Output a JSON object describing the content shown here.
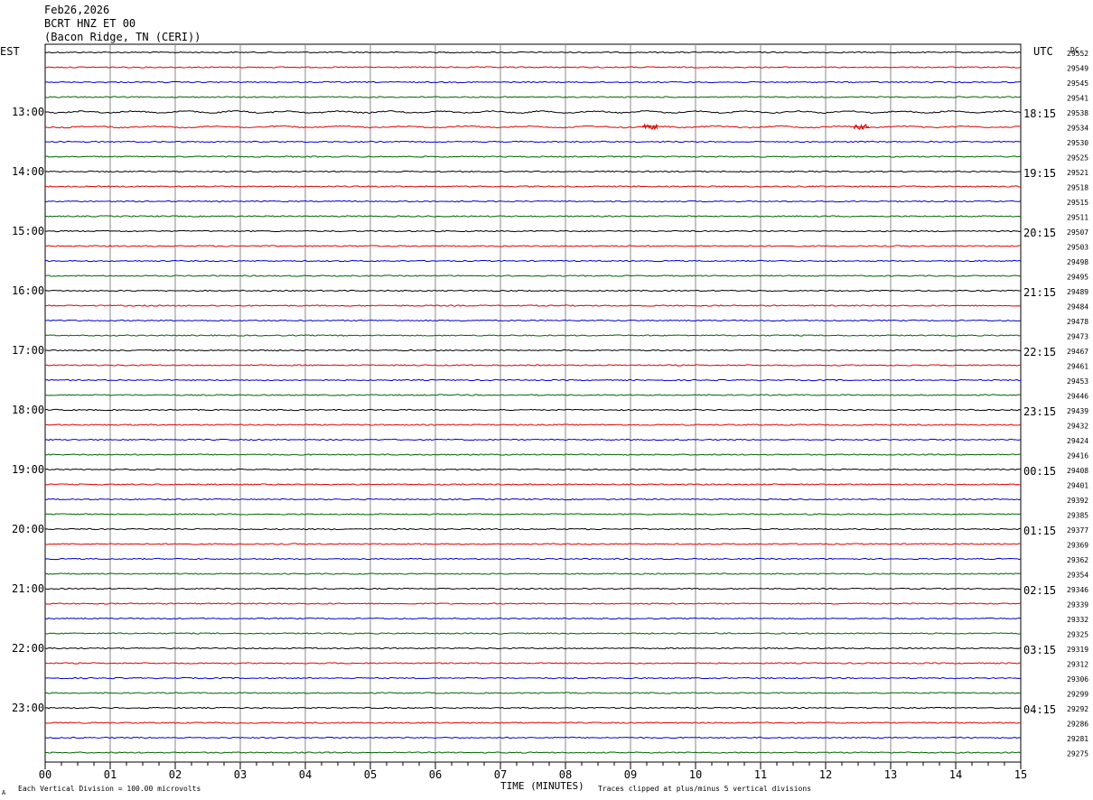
{
  "header": {
    "date": "Feb26,2026",
    "station": "BCRT HNZ ET 00",
    "location": "(Bacon Ridge, TN (CERI))"
  },
  "left_label": "EST",
  "right_label": "UTC",
  "dc_label": "DC",
  "footer": {
    "scale_note": "Each Vertical Division =  100.00 microvolts",
    "xlabel": "TIME (MINUTES)",
    "clip_note": "Traces clipped at plus/minus 5 vertical divisions",
    "corner_mark": "A"
  },
  "chart_data": {
    "type": "line",
    "title": "BCRT HNZ ET 00",
    "xlabel": "TIME (MINUTES)",
    "x_ticks": [
      "00",
      "01",
      "02",
      "03",
      "04",
      "05",
      "06",
      "07",
      "08",
      "09",
      "10",
      "11",
      "12",
      "13",
      "14",
      "15"
    ],
    "xlim": [
      0,
      15
    ],
    "grid": true,
    "trace_colors": [
      "#000000",
      "#e00000",
      "#0000d0",
      "#006400"
    ],
    "est_hour_labels": [
      {
        "row": 4,
        "label": "13:00"
      },
      {
        "row": 8,
        "label": "14:00"
      },
      {
        "row": 12,
        "label": "15:00"
      },
      {
        "row": 16,
        "label": "16:00"
      },
      {
        "row": 20,
        "label": "17:00"
      },
      {
        "row": 24,
        "label": "18:00"
      },
      {
        "row": 28,
        "label": "19:00"
      },
      {
        "row": 32,
        "label": "20:00"
      },
      {
        "row": 36,
        "label": "21:00"
      },
      {
        "row": 40,
        "label": "22:00"
      },
      {
        "row": 44,
        "label": "23:00"
      }
    ],
    "utc_hour_labels": [
      {
        "row": 4,
        "label": "18:15"
      },
      {
        "row": 8,
        "label": "19:15"
      },
      {
        "row": 12,
        "label": "20:15"
      },
      {
        "row": 16,
        "label": "21:15"
      },
      {
        "row": 20,
        "label": "22:15"
      },
      {
        "row": 24,
        "label": "23:15"
      },
      {
        "row": 28,
        "label": "00:15"
      },
      {
        "row": 32,
        "label": "01:15"
      },
      {
        "row": 36,
        "label": "02:15"
      },
      {
        "row": 40,
        "label": "03:15"
      },
      {
        "row": 44,
        "label": "04:15"
      }
    ],
    "dc_values": [
      "29552",
      "29549",
      "29545",
      "29541",
      "29538",
      "29534",
      "29530",
      "29525",
      "29521",
      "29518",
      "29515",
      "29511",
      "29507",
      "29503",
      "29498",
      "29495",
      "29489",
      "29484",
      "29478",
      "29473",
      "29467",
      "29461",
      "29453",
      "29446",
      "29439",
      "29432",
      "29424",
      "29416",
      "29408",
      "29401",
      "29392",
      "29385",
      "29377",
      "29369",
      "29362",
      "29354",
      "29346",
      "29339",
      "29332",
      "29325",
      "29319",
      "29312",
      "29306",
      "29299",
      "29292",
      "29286",
      "29281",
      "29275"
    ],
    "events": [
      {
        "row": 5,
        "minute": 9.3,
        "label": ""
      },
      {
        "row": 5,
        "minute": 12.55,
        "label": ""
      }
    ]
  }
}
